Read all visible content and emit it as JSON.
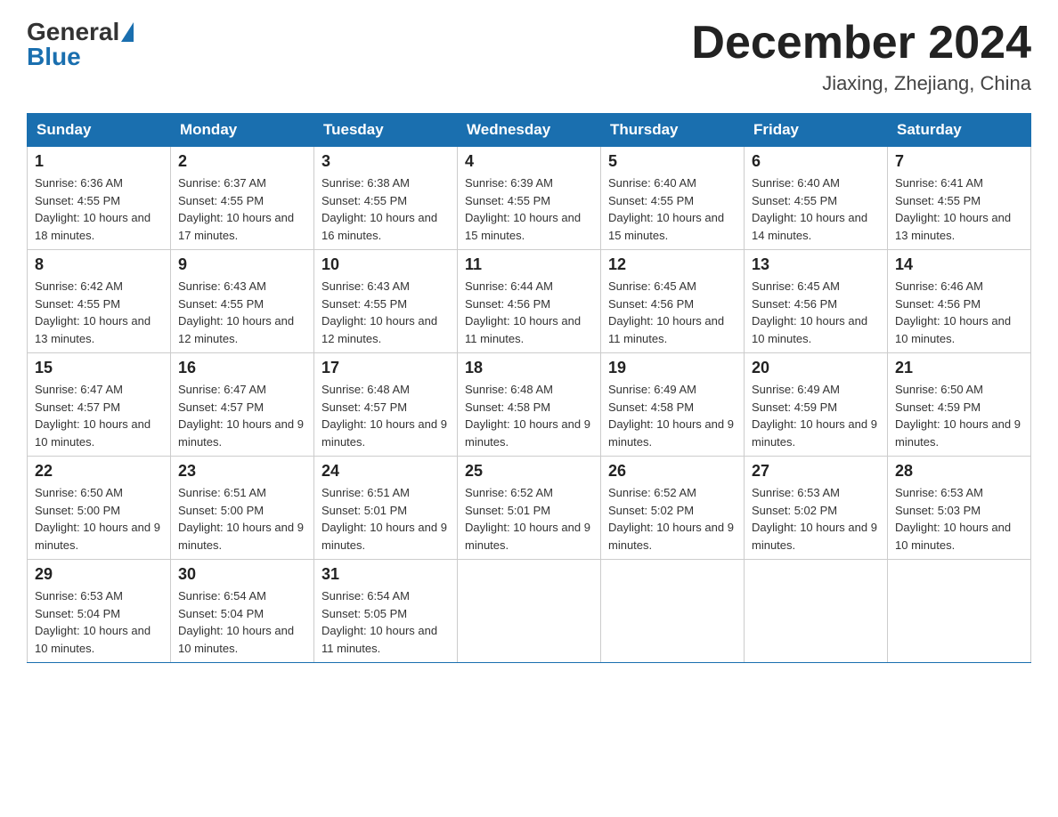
{
  "header": {
    "logo_general": "General",
    "logo_blue": "Blue",
    "title": "December 2024",
    "location": "Jiaxing, Zhejiang, China"
  },
  "days_of_week": [
    "Sunday",
    "Monday",
    "Tuesday",
    "Wednesday",
    "Thursday",
    "Friday",
    "Saturday"
  ],
  "weeks": [
    [
      {
        "day": "1",
        "sunrise": "6:36 AM",
        "sunset": "4:55 PM",
        "daylight": "10 hours and 18 minutes."
      },
      {
        "day": "2",
        "sunrise": "6:37 AM",
        "sunset": "4:55 PM",
        "daylight": "10 hours and 17 minutes."
      },
      {
        "day": "3",
        "sunrise": "6:38 AM",
        "sunset": "4:55 PM",
        "daylight": "10 hours and 16 minutes."
      },
      {
        "day": "4",
        "sunrise": "6:39 AM",
        "sunset": "4:55 PM",
        "daylight": "10 hours and 15 minutes."
      },
      {
        "day": "5",
        "sunrise": "6:40 AM",
        "sunset": "4:55 PM",
        "daylight": "10 hours and 15 minutes."
      },
      {
        "day": "6",
        "sunrise": "6:40 AM",
        "sunset": "4:55 PM",
        "daylight": "10 hours and 14 minutes."
      },
      {
        "day": "7",
        "sunrise": "6:41 AM",
        "sunset": "4:55 PM",
        "daylight": "10 hours and 13 minutes."
      }
    ],
    [
      {
        "day": "8",
        "sunrise": "6:42 AM",
        "sunset": "4:55 PM",
        "daylight": "10 hours and 13 minutes."
      },
      {
        "day": "9",
        "sunrise": "6:43 AM",
        "sunset": "4:55 PM",
        "daylight": "10 hours and 12 minutes."
      },
      {
        "day": "10",
        "sunrise": "6:43 AM",
        "sunset": "4:55 PM",
        "daylight": "10 hours and 12 minutes."
      },
      {
        "day": "11",
        "sunrise": "6:44 AM",
        "sunset": "4:56 PM",
        "daylight": "10 hours and 11 minutes."
      },
      {
        "day": "12",
        "sunrise": "6:45 AM",
        "sunset": "4:56 PM",
        "daylight": "10 hours and 11 minutes."
      },
      {
        "day": "13",
        "sunrise": "6:45 AM",
        "sunset": "4:56 PM",
        "daylight": "10 hours and 10 minutes."
      },
      {
        "day": "14",
        "sunrise": "6:46 AM",
        "sunset": "4:56 PM",
        "daylight": "10 hours and 10 minutes."
      }
    ],
    [
      {
        "day": "15",
        "sunrise": "6:47 AM",
        "sunset": "4:57 PM",
        "daylight": "10 hours and 10 minutes."
      },
      {
        "day": "16",
        "sunrise": "6:47 AM",
        "sunset": "4:57 PM",
        "daylight": "10 hours and 9 minutes."
      },
      {
        "day": "17",
        "sunrise": "6:48 AM",
        "sunset": "4:57 PM",
        "daylight": "10 hours and 9 minutes."
      },
      {
        "day": "18",
        "sunrise": "6:48 AM",
        "sunset": "4:58 PM",
        "daylight": "10 hours and 9 minutes."
      },
      {
        "day": "19",
        "sunrise": "6:49 AM",
        "sunset": "4:58 PM",
        "daylight": "10 hours and 9 minutes."
      },
      {
        "day": "20",
        "sunrise": "6:49 AM",
        "sunset": "4:59 PM",
        "daylight": "10 hours and 9 minutes."
      },
      {
        "day": "21",
        "sunrise": "6:50 AM",
        "sunset": "4:59 PM",
        "daylight": "10 hours and 9 minutes."
      }
    ],
    [
      {
        "day": "22",
        "sunrise": "6:50 AM",
        "sunset": "5:00 PM",
        "daylight": "10 hours and 9 minutes."
      },
      {
        "day": "23",
        "sunrise": "6:51 AM",
        "sunset": "5:00 PM",
        "daylight": "10 hours and 9 minutes."
      },
      {
        "day": "24",
        "sunrise": "6:51 AM",
        "sunset": "5:01 PM",
        "daylight": "10 hours and 9 minutes."
      },
      {
        "day": "25",
        "sunrise": "6:52 AM",
        "sunset": "5:01 PM",
        "daylight": "10 hours and 9 minutes."
      },
      {
        "day": "26",
        "sunrise": "6:52 AM",
        "sunset": "5:02 PM",
        "daylight": "10 hours and 9 minutes."
      },
      {
        "day": "27",
        "sunrise": "6:53 AM",
        "sunset": "5:02 PM",
        "daylight": "10 hours and 9 minutes."
      },
      {
        "day": "28",
        "sunrise": "6:53 AM",
        "sunset": "5:03 PM",
        "daylight": "10 hours and 10 minutes."
      }
    ],
    [
      {
        "day": "29",
        "sunrise": "6:53 AM",
        "sunset": "5:04 PM",
        "daylight": "10 hours and 10 minutes."
      },
      {
        "day": "30",
        "sunrise": "6:54 AM",
        "sunset": "5:04 PM",
        "daylight": "10 hours and 10 minutes."
      },
      {
        "day": "31",
        "sunrise": "6:54 AM",
        "sunset": "5:05 PM",
        "daylight": "10 hours and 11 minutes."
      },
      null,
      null,
      null,
      null
    ]
  ],
  "labels": {
    "sunrise_prefix": "Sunrise: ",
    "sunset_prefix": "Sunset: ",
    "daylight_prefix": "Daylight: "
  }
}
